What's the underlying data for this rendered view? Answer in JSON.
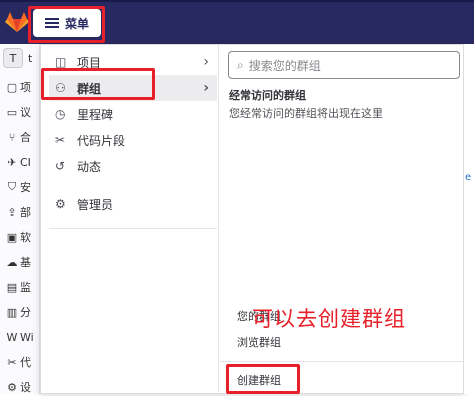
{
  "topbar": {
    "menu_label": "菜单"
  },
  "left_sidebar": {
    "avatar_letter": "T",
    "project_initial": "t",
    "items": [
      {
        "icon": "project-icon",
        "glyph": "▢",
        "text": "项"
      },
      {
        "icon": "doc-icon",
        "glyph": "▭",
        "text": "议"
      },
      {
        "icon": "merge-icon",
        "glyph": "⑂",
        "text": "合"
      },
      {
        "icon": "rocket-icon",
        "glyph": "✈",
        "text": "CI"
      },
      {
        "icon": "shield-icon",
        "glyph": "⛉",
        "text": "安"
      },
      {
        "icon": "deploy-icon",
        "glyph": "⇪",
        "text": "部"
      },
      {
        "icon": "package-icon",
        "glyph": "▣",
        "text": "软"
      },
      {
        "icon": "cloud-icon",
        "glyph": "☁",
        "text": "基"
      },
      {
        "icon": "monitor-icon",
        "glyph": "▤",
        "text": "监"
      },
      {
        "icon": "chart-icon",
        "glyph": "▥",
        "text": "分"
      },
      {
        "icon": "wiki-icon",
        "glyph": "W",
        "text": "Wi"
      },
      {
        "icon": "snippet-icon",
        "glyph": "✂",
        "text": "代"
      },
      {
        "icon": "settings-icon",
        "glyph": "⚙",
        "text": "设"
      }
    ]
  },
  "menu": {
    "items": [
      {
        "key": "projects",
        "label": "项目",
        "icon": "project-icon",
        "glyph": "◫",
        "has_submenu": true,
        "active": false
      },
      {
        "key": "groups",
        "label": "群组",
        "icon": "group-icon",
        "glyph": "⚇",
        "has_submenu": true,
        "active": true
      },
      {
        "key": "milestones",
        "label": "里程碑",
        "icon": "clock-icon",
        "glyph": "◷",
        "has_submenu": false,
        "active": false
      },
      {
        "key": "snippets",
        "label": "代码片段",
        "icon": "scissors-icon",
        "glyph": "✂",
        "has_submenu": false,
        "active": false
      },
      {
        "key": "activity",
        "label": "动态",
        "icon": "history-icon",
        "glyph": "↺",
        "has_submenu": false,
        "active": false
      },
      {
        "key": "admin",
        "label": "管理员",
        "icon": "admin-icon",
        "glyph": "⚙",
        "has_submenu": false,
        "active": false
      }
    ]
  },
  "groups_panel": {
    "search_placeholder": "搜索您的群组",
    "frequent_title": "经常访问的群组",
    "frequent_empty": "您经常访问的群组将出现在这里",
    "your_groups": "您的群组",
    "explore_groups": "浏览群组",
    "create_group": "创建群组"
  },
  "annotation": {
    "text": "可以去创建群组",
    "color": "#e8202a"
  },
  "colors": {
    "topbar": "#292961",
    "highlight": "#e8202a",
    "active_bg": "#ececef"
  }
}
